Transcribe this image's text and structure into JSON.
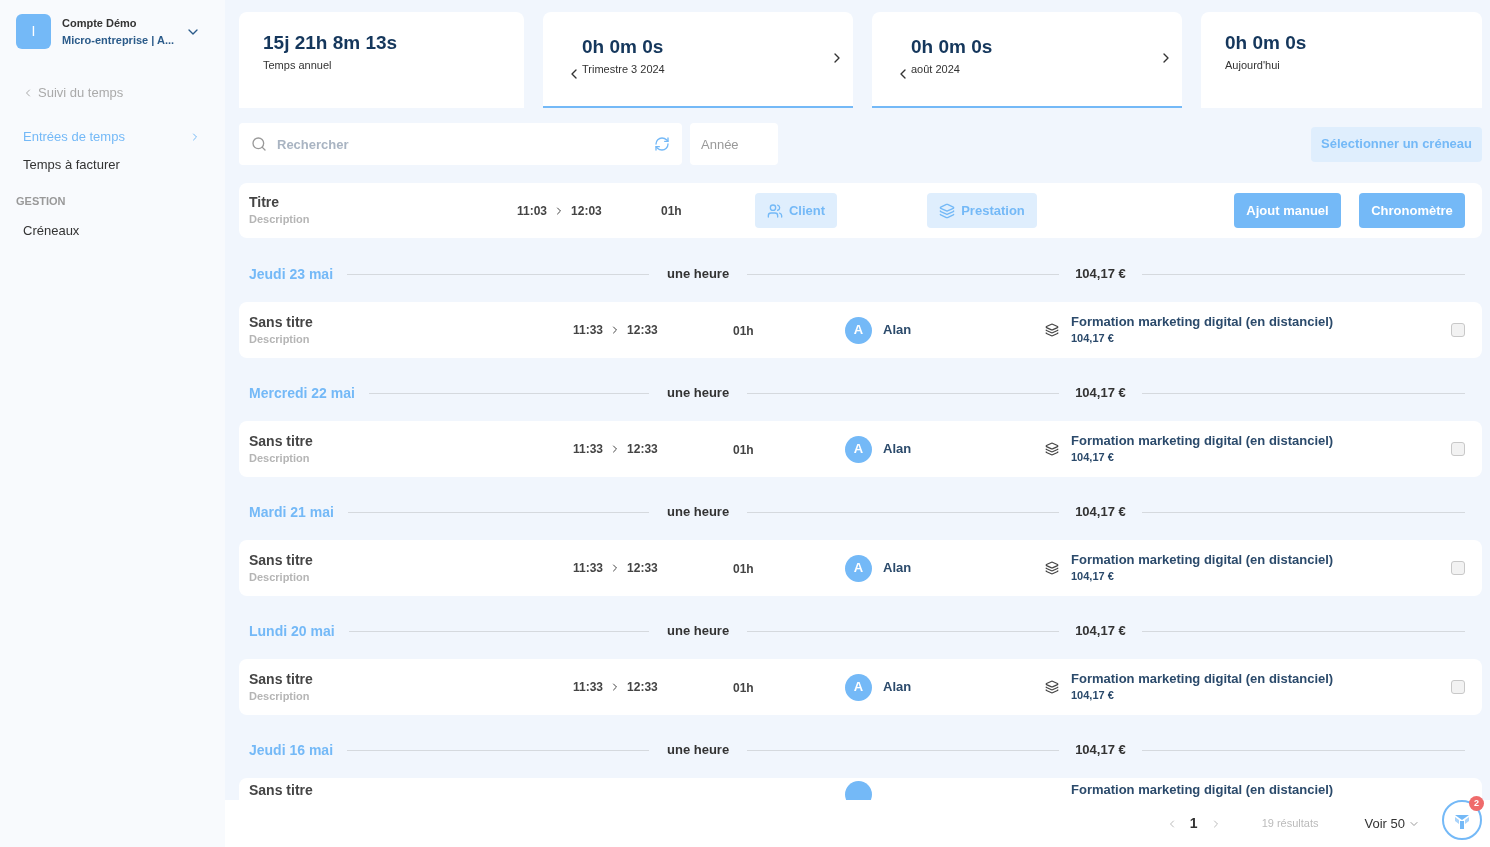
{
  "account": {
    "initial": "I",
    "name": "Compte Démo",
    "subtitle": "Micro-entreprise | A..."
  },
  "sidebar": {
    "back": "Suivi du temps",
    "items": [
      {
        "label": "Entrées de temps",
        "selected": true
      },
      {
        "label": "Temps à facturer",
        "selected": false
      }
    ],
    "sections": [
      {
        "title": "GESTION",
        "items": [
          {
            "label": "Créneaux",
            "selected": false
          }
        ]
      }
    ]
  },
  "stats": [
    {
      "value": "15j 21h 8m 13s",
      "label": "Temps annuel",
      "kind": "plain",
      "selected": false
    },
    {
      "value": "0h 0m 0s",
      "label": "Trimestre 3 2024",
      "kind": "nav",
      "selected": true
    },
    {
      "value": "0h 0m 0s",
      "label": "août 2024",
      "kind": "nav",
      "selected": true
    },
    {
      "value": "0h 0m 0s",
      "label": "Aujourd'hui",
      "kind": "plain",
      "selected": false
    }
  ],
  "search": {
    "placeholder": "Rechercher"
  },
  "year": {
    "placeholder": "Année"
  },
  "select_slot_button": "Sélectionner un créneau",
  "new_entry": {
    "title": "Titre",
    "description": "Description",
    "start": "11:03",
    "end": "12:03",
    "duration": "01h",
    "client_button": "Client",
    "service_button": "Prestation",
    "manual_button": "Ajout manuel",
    "timer_button": "Chronomètre"
  },
  "groups": [
    {
      "date": "Jeudi 23 mai",
      "total_time": "une heure",
      "total_amount": "104,17 €",
      "entries": [
        {
          "title": "Sans titre",
          "description": "Description",
          "start": "11:33",
          "end": "12:33",
          "duration": "01h",
          "client_initial": "A",
          "client": "Alan",
          "service": "Formation marketing digital (en distanciel)",
          "amount": "104,17 €",
          "checked": false
        }
      ]
    },
    {
      "date": "Mercredi 22 mai",
      "total_time": "une heure",
      "total_amount": "104,17 €",
      "entries": [
        {
          "title": "Sans titre",
          "description": "Description",
          "start": "11:33",
          "end": "12:33",
          "duration": "01h",
          "client_initial": "A",
          "client": "Alan",
          "service": "Formation marketing digital (en distanciel)",
          "amount": "104,17 €",
          "checked": false
        }
      ]
    },
    {
      "date": "Mardi 21 mai",
      "total_time": "une heure",
      "total_amount": "104,17 €",
      "entries": [
        {
          "title": "Sans titre",
          "description": "Description",
          "start": "11:33",
          "end": "12:33",
          "duration": "01h",
          "client_initial": "A",
          "client": "Alan",
          "service": "Formation marketing digital (en distanciel)",
          "amount": "104,17 €",
          "checked": false
        }
      ]
    },
    {
      "date": "Lundi 20 mai",
      "total_time": "une heure",
      "total_amount": "104,17 €",
      "entries": [
        {
          "title": "Sans titre",
          "description": "Description",
          "start": "11:33",
          "end": "12:33",
          "duration": "01h",
          "client_initial": "A",
          "client": "Alan",
          "service": "Formation marketing digital (en distanciel)",
          "amount": "104,17 €",
          "checked": false
        }
      ]
    },
    {
      "date": "Jeudi 16 mai",
      "total_time": "une heure",
      "total_amount": "104,17 €",
      "entries": [
        {
          "title": "Sans titre",
          "service": "Formation marketing digital (en distanciel)"
        }
      ]
    }
  ],
  "pagination": {
    "page": "1",
    "results": "19 résultats",
    "per_page": "Voir 50"
  },
  "help": {
    "badge": "2"
  }
}
